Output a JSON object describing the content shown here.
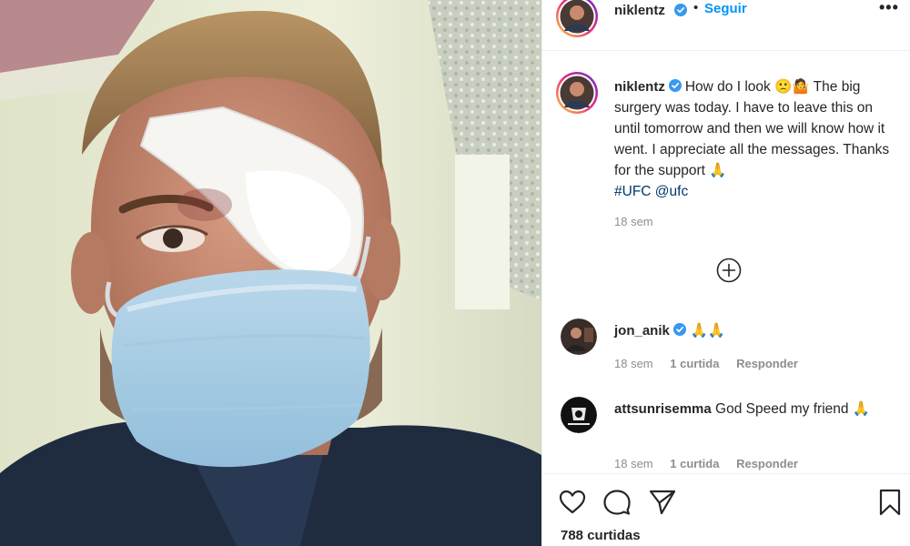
{
  "post": {
    "username": "niklentz",
    "follow_label": "Seguir",
    "separator": "•",
    "more_label": "•••",
    "caption": "How do I look 🙁🤷 The big surgery was today. I have to leave this on until tomorrow and then we will know how it went. I appreciate all the messages. Thanks for the support 🙏",
    "hashtag": "#UFC",
    "mention": "@ufc",
    "time": "18 sem",
    "likes": "788 curtidas"
  },
  "comments": [
    {
      "username": "jon_anik",
      "verified": true,
      "text": "🙏🙏",
      "time": "18 sem",
      "likes": "1 curtida",
      "reply": "Responder"
    },
    {
      "username": "attsunrisemma",
      "verified": false,
      "text": "God Speed my friend 🙏",
      "time": "18 sem",
      "likes": "1 curtida",
      "reply": "Responder"
    }
  ],
  "icons": {
    "verified": "verified-badge-icon",
    "load_more": "plus-circle-icon",
    "like": "heart-icon",
    "comment": "comment-bubble-icon",
    "share": "paper-plane-icon",
    "save": "bookmark-icon"
  },
  "colors": {
    "accent": "#0095f6",
    "text": "#262626",
    "muted": "#8e8e8e",
    "hashtag": "#00376b",
    "story_ring_start": "#f9ce34",
    "story_ring_end": "#ee2a7b"
  }
}
